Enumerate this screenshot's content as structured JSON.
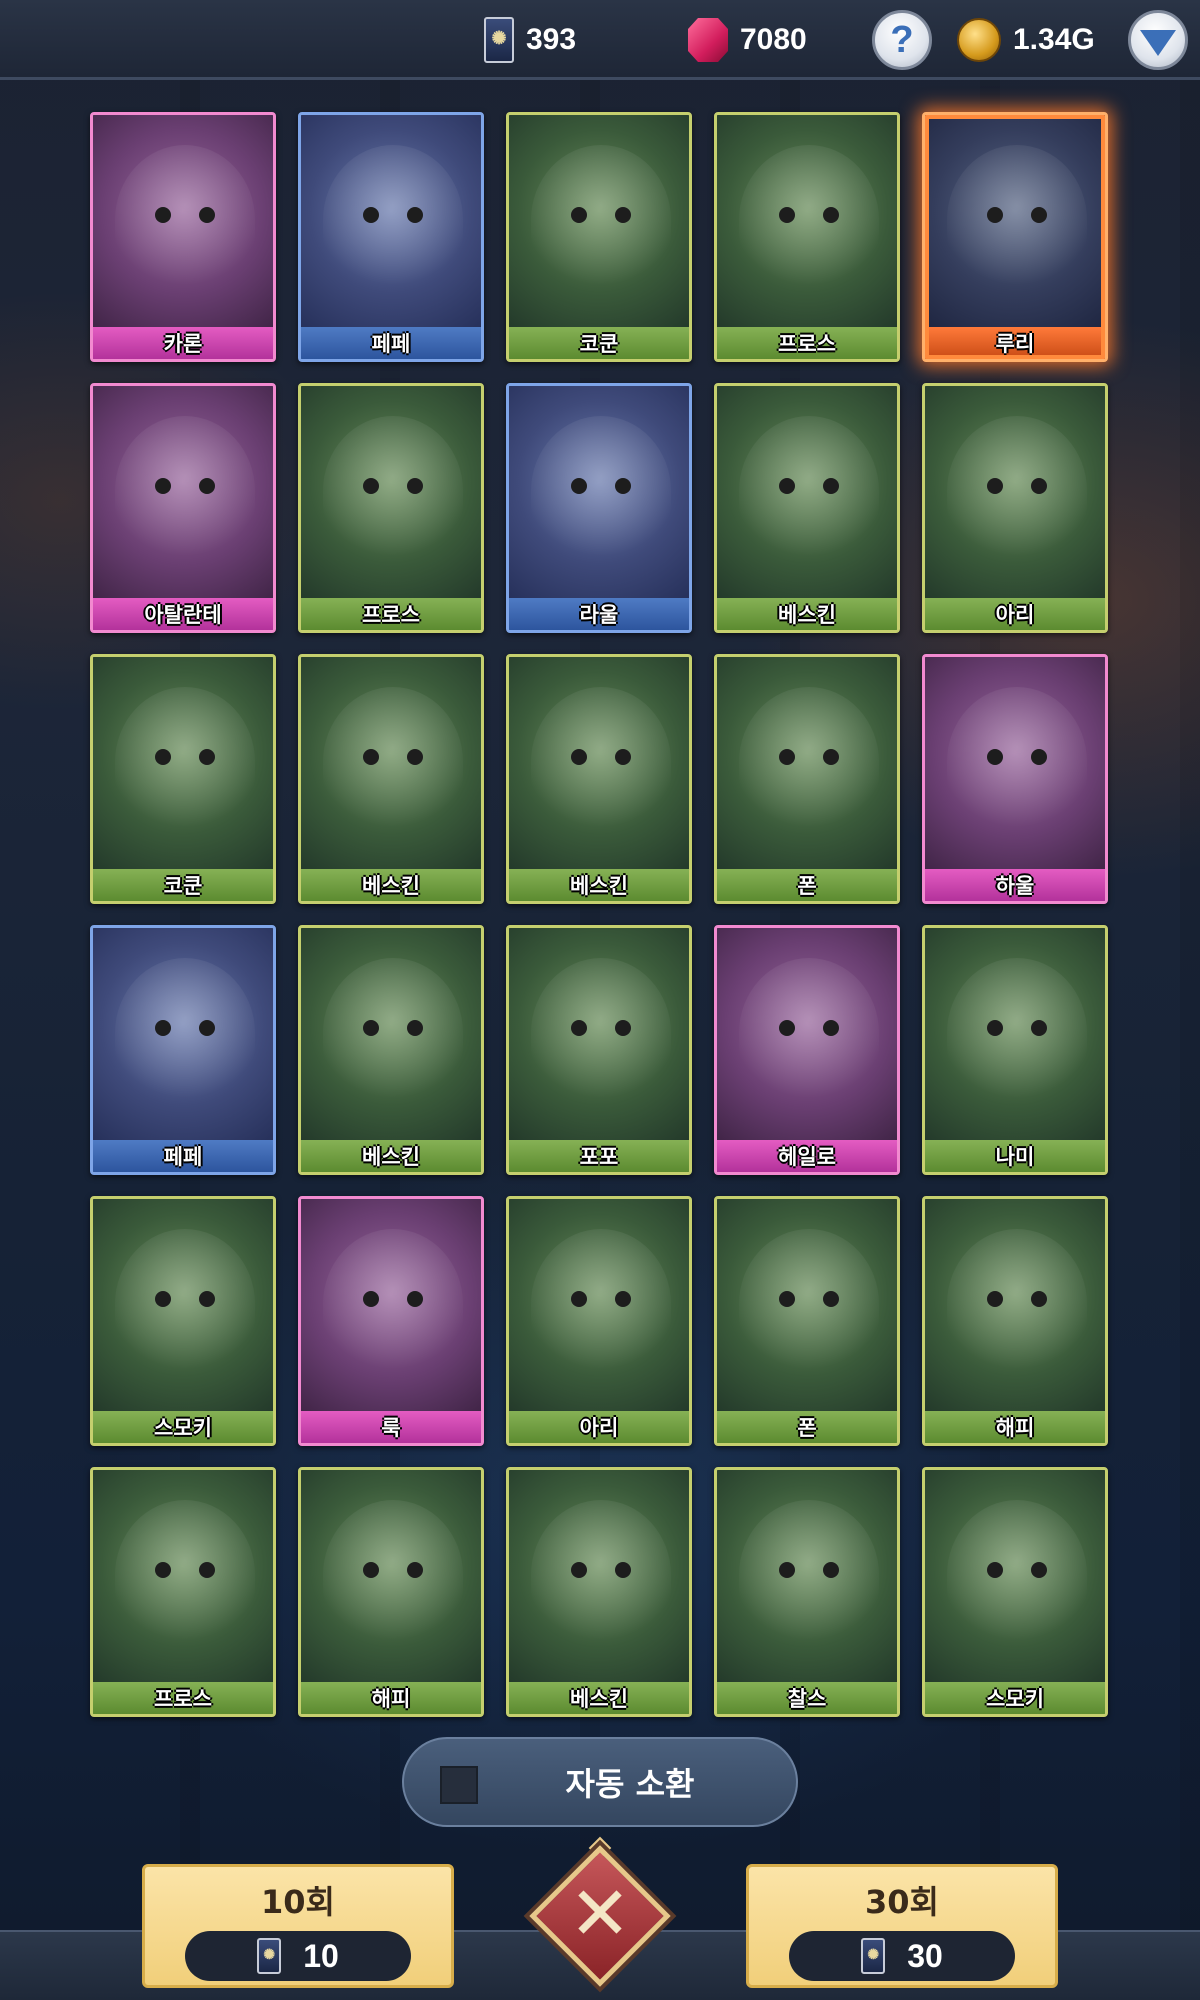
{
  "topbar": {
    "tickets": "393",
    "gems": "7080",
    "gold": "1.34G",
    "help_label": "?",
    "icons": [
      "ticket-icon",
      "gem-icon",
      "help-icon",
      "gold-coin-icon",
      "dropdown-icon"
    ]
  },
  "cards": [
    {
      "name": "카론",
      "rarity": "pink"
    },
    {
      "name": "페페",
      "rarity": "blue"
    },
    {
      "name": "코쿤",
      "rarity": "green"
    },
    {
      "name": "프로스",
      "rarity": "green"
    },
    {
      "name": "루리",
      "rarity": "orange"
    },
    {
      "name": "아탈란테",
      "rarity": "pink"
    },
    {
      "name": "프로스",
      "rarity": "green"
    },
    {
      "name": "라울",
      "rarity": "blue"
    },
    {
      "name": "베스킨",
      "rarity": "green"
    },
    {
      "name": "아리",
      "rarity": "green"
    },
    {
      "name": "코쿤",
      "rarity": "green"
    },
    {
      "name": "베스킨",
      "rarity": "green"
    },
    {
      "name": "베스킨",
      "rarity": "green"
    },
    {
      "name": "폰",
      "rarity": "green"
    },
    {
      "name": "하울",
      "rarity": "pink"
    },
    {
      "name": "페페",
      "rarity": "blue"
    },
    {
      "name": "베스킨",
      "rarity": "green"
    },
    {
      "name": "포포",
      "rarity": "green"
    },
    {
      "name": "헤일로",
      "rarity": "pink"
    },
    {
      "name": "나미",
      "rarity": "green"
    },
    {
      "name": "스모키",
      "rarity": "green"
    },
    {
      "name": "룩",
      "rarity": "pink"
    },
    {
      "name": "아리",
      "rarity": "green"
    },
    {
      "name": "폰",
      "rarity": "green"
    },
    {
      "name": "해피",
      "rarity": "green"
    },
    {
      "name": "프로스",
      "rarity": "green"
    },
    {
      "name": "해피",
      "rarity": "green"
    },
    {
      "name": "베스킨",
      "rarity": "green"
    },
    {
      "name": "찰스",
      "rarity": "green"
    },
    {
      "name": "스모키",
      "rarity": "green"
    }
  ],
  "auto_summon": {
    "label": "자동 소환",
    "checked": false
  },
  "summon_10": {
    "title": "10회",
    "cost": "10"
  },
  "summon_30": {
    "title": "30회",
    "cost": "30"
  },
  "close": {
    "label": "✕"
  },
  "colors": {
    "green": "#86b155",
    "blue": "#4f7bc4",
    "pink": "#e45cc2",
    "orange": "#ff7a3a",
    "button": "#f1cf7a"
  }
}
